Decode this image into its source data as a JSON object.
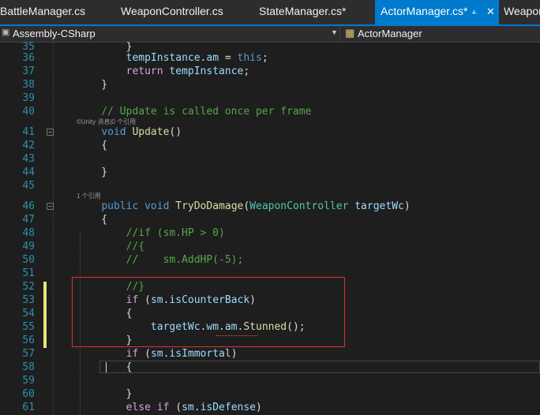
{
  "tabs": [
    {
      "label": "BattleManager.cs",
      "active": false
    },
    {
      "label": "WeaponController.cs",
      "active": false
    },
    {
      "label": "StateManager.cs*",
      "active": false
    },
    {
      "label": "ActorManager.cs*",
      "active": true,
      "pin_icon": "⫠",
      "close_icon": "✕"
    },
    {
      "label": "Weapon",
      "active": false
    }
  ],
  "navbar": {
    "project": "Assembly-CSharp",
    "class_name": "ActorManager",
    "project_dropdown_icon": "▼",
    "class_icon": "▦"
  },
  "lenses": {
    "update": "©Unity 消息|0 个引用",
    "trydodamage": "1 个引用"
  },
  "lines": [
    {
      "n": "35",
      "tokens": [
        {
          "t": "        }",
          "c": "#dcdcdc"
        }
      ]
    },
    {
      "n": "36",
      "tokens": [
        {
          "t": "        ",
          "c": "#dcdcdc"
        },
        {
          "t": "tempInstance",
          "c": "#9cdcfe"
        },
        {
          "t": ".",
          "c": "#dcdcdc"
        },
        {
          "t": "am",
          "c": "#9cdcfe"
        },
        {
          "t": " = ",
          "c": "#dcdcdc"
        },
        {
          "t": "this",
          "c": "#569cd6"
        },
        {
          "t": ";",
          "c": "#dcdcdc"
        }
      ]
    },
    {
      "n": "37",
      "tokens": [
        {
          "t": "        ",
          "c": "#dcdcdc"
        },
        {
          "t": "return",
          "c": "#d8a0df"
        },
        {
          "t": " ",
          "c": "#dcdcdc"
        },
        {
          "t": "tempInstance",
          "c": "#9cdcfe"
        },
        {
          "t": ";",
          "c": "#dcdcdc"
        }
      ]
    },
    {
      "n": "38",
      "tokens": [
        {
          "t": "    }",
          "c": "#dcdcdc"
        }
      ]
    },
    {
      "n": "39",
      "tokens": []
    },
    {
      "n": "40",
      "tokens": [
        {
          "t": "    // Update is called once per frame",
          "c": "#57a64a"
        }
      ]
    },
    {
      "n": "41",
      "tokens": [
        {
          "t": "    ",
          "c": "#dcdcdc"
        },
        {
          "t": "void",
          "c": "#569cd6"
        },
        {
          "t": " ",
          "c": "#dcdcdc"
        },
        {
          "t": "Update",
          "c": "#dcdcaa"
        },
        {
          "t": "()",
          "c": "#dcdcdc"
        }
      ]
    },
    {
      "n": "42",
      "tokens": [
        {
          "t": "    {",
          "c": "#dcdcdc"
        }
      ]
    },
    {
      "n": "43",
      "tokens": []
    },
    {
      "n": "44",
      "tokens": [
        {
          "t": "    }",
          "c": "#dcdcdc"
        }
      ]
    },
    {
      "n": "45",
      "tokens": []
    },
    {
      "n": "46",
      "tokens": [
        {
          "t": "    ",
          "c": "#dcdcdc"
        },
        {
          "t": "public",
          "c": "#569cd6"
        },
        {
          "t": " ",
          "c": "#dcdcdc"
        },
        {
          "t": "void",
          "c": "#569cd6"
        },
        {
          "t": " ",
          "c": "#dcdcdc"
        },
        {
          "t": "TryDoDamage",
          "c": "#dcdcaa"
        },
        {
          "t": "(",
          "c": "#dcdcdc"
        },
        {
          "t": "WeaponController",
          "c": "#4ec9b0"
        },
        {
          "t": " ",
          "c": "#dcdcdc"
        },
        {
          "t": "targetWc",
          "c": "#9cdcfe"
        },
        {
          "t": ")",
          "c": "#dcdcdc"
        }
      ]
    },
    {
      "n": "47",
      "tokens": [
        {
          "t": "    {",
          "c": "#dcdcdc"
        }
      ]
    },
    {
      "n": "48",
      "tokens": [
        {
          "t": "        //if (sm.HP > 0)",
          "c": "#57a64a"
        }
      ]
    },
    {
      "n": "49",
      "tokens": [
        {
          "t": "        //{",
          "c": "#57a64a"
        }
      ]
    },
    {
      "n": "50",
      "tokens": [
        {
          "t": "        //    sm.AddHP(-5);",
          "c": "#57a64a"
        }
      ]
    },
    {
      "n": "51",
      "tokens": []
    },
    {
      "n": "52",
      "tokens": [
        {
          "t": "        //}",
          "c": "#57a64a"
        }
      ]
    },
    {
      "n": "53",
      "tokens": [
        {
          "t": "        ",
          "c": "#dcdcdc"
        },
        {
          "t": "if",
          "c": "#d8a0df"
        },
        {
          "t": " (",
          "c": "#dcdcdc"
        },
        {
          "t": "sm",
          "c": "#9cdcfe"
        },
        {
          "t": ".",
          "c": "#dcdcdc"
        },
        {
          "t": "isCounterBack",
          "c": "#9cdcfe"
        },
        {
          "t": ")",
          "c": "#dcdcdc"
        }
      ]
    },
    {
      "n": "54",
      "tokens": [
        {
          "t": "        {",
          "c": "#dcdcdc"
        }
      ]
    },
    {
      "n": "55",
      "tokens": [
        {
          "t": "            ",
          "c": "#dcdcdc"
        },
        {
          "t": "targetWc",
          "c": "#9cdcfe"
        },
        {
          "t": ".",
          "c": "#dcdcdc"
        },
        {
          "t": "wm",
          "c": "#9cdcfe"
        },
        {
          "t": ".",
          "c": "#dcdcdc"
        },
        {
          "t": "am",
          "c": "#9cdcfe"
        },
        {
          "t": ".",
          "c": "#dcdcdc"
        },
        {
          "t": "Stunned",
          "c": "#dcdcaa"
        },
        {
          "t": "();",
          "c": "#dcdcdc"
        }
      ]
    },
    {
      "n": "56",
      "tokens": [
        {
          "t": "        }",
          "c": "#dcdcdc"
        }
      ]
    },
    {
      "n": "57",
      "tokens": [
        {
          "t": "        ",
          "c": "#dcdcdc"
        },
        {
          "t": "if",
          "c": "#d8a0df"
        },
        {
          "t": " (",
          "c": "#dcdcdc"
        },
        {
          "t": "sm",
          "c": "#9cdcfe"
        },
        {
          "t": ".",
          "c": "#dcdcdc"
        },
        {
          "t": "isImmortal",
          "c": "#9cdcfe"
        },
        {
          "t": ")",
          "c": "#dcdcdc"
        }
      ]
    },
    {
      "n": "58",
      "tokens": [
        {
          "t": "        {",
          "c": "#dcdcdc"
        }
      ]
    },
    {
      "n": "59",
      "tokens": []
    },
    {
      "n": "60",
      "tokens": [
        {
          "t": "        }",
          "c": "#dcdcdc"
        }
      ]
    },
    {
      "n": "61",
      "tokens": [
        {
          "t": "        ",
          "c": "#dcdcdc"
        },
        {
          "t": "else",
          "c": "#d8a0df"
        },
        {
          "t": " ",
          "c": "#dcdcdc"
        },
        {
          "t": "if",
          "c": "#d8a0df"
        },
        {
          "t": " (",
          "c": "#dcdcdc"
        },
        {
          "t": "sm",
          "c": "#9cdcfe"
        },
        {
          "t": ".",
          "c": "#dcdcdc"
        },
        {
          "t": "isDefense",
          "c": "#9cdcfe"
        },
        {
          "t": ")",
          "c": "#dcdcdc"
        }
      ]
    }
  ],
  "fold_icon": "−",
  "colors": {
    "accent": "#007acc",
    "highlight_box": "#e03232",
    "modified_margin": "#e6e675",
    "line_number": "#2b91af"
  }
}
